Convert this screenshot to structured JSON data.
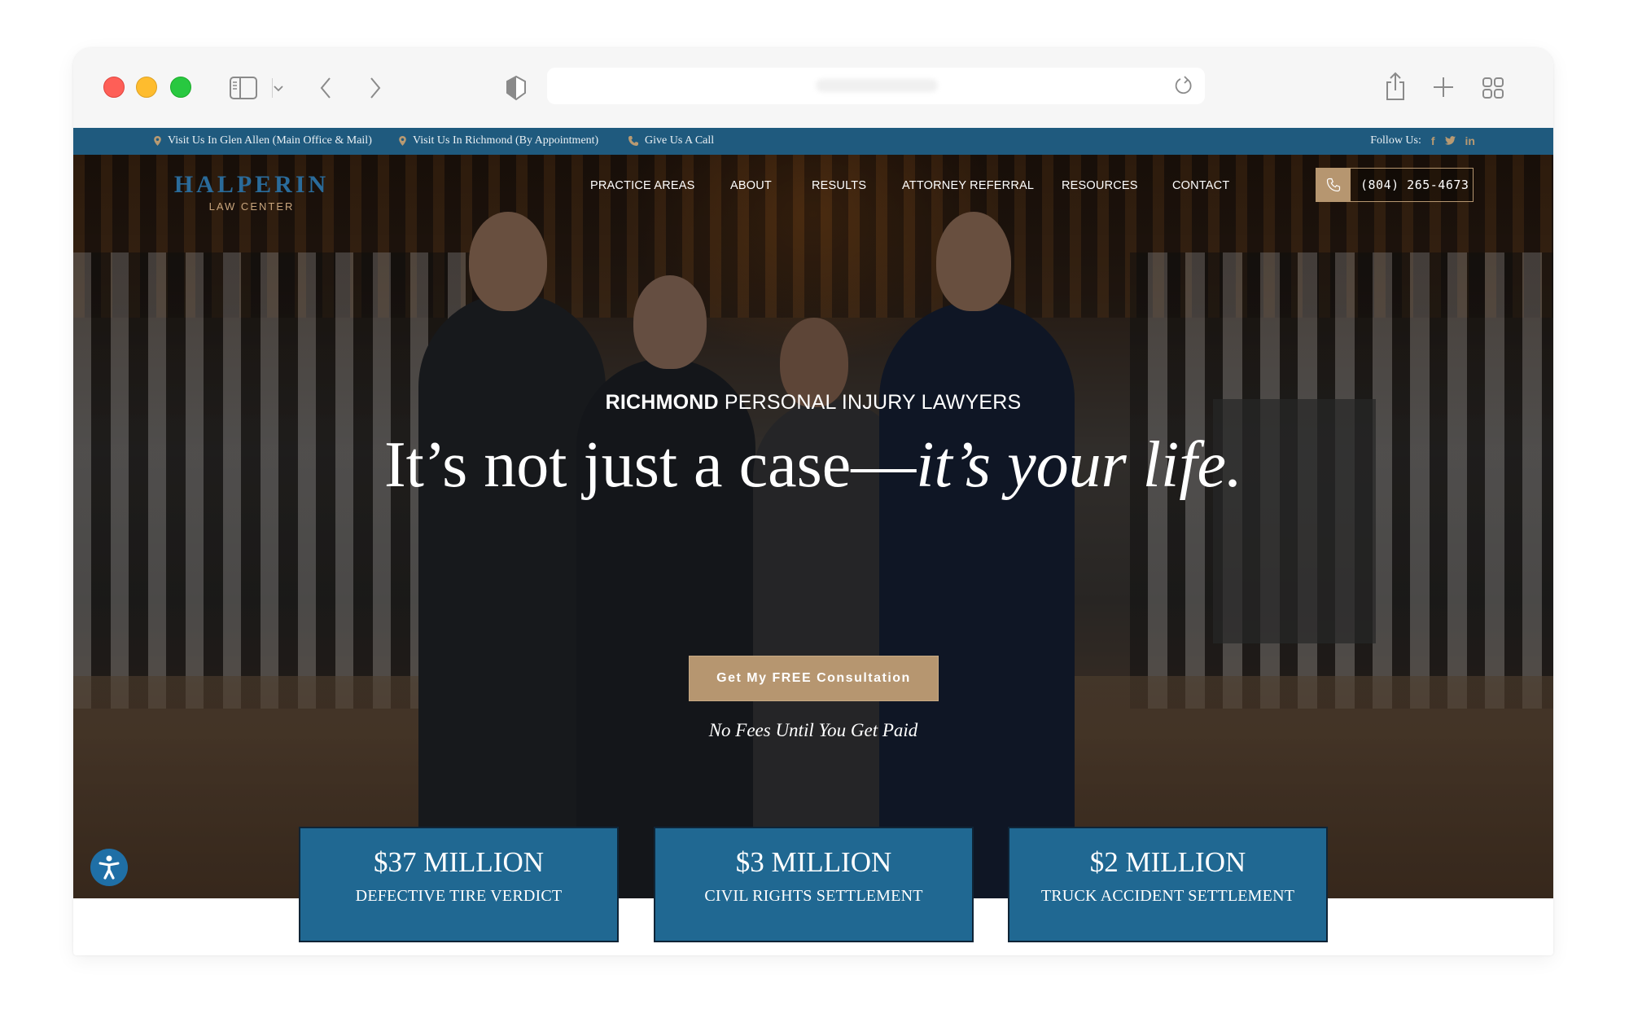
{
  "browser": {
    "traffic_lights": [
      "close",
      "minimize",
      "zoom"
    ],
    "url": ""
  },
  "topbar": {
    "items": [
      {
        "icon": "map-pin-icon",
        "label": "Visit Us In Glen Allen (Main Office & Mail)"
      },
      {
        "icon": "map-pin-icon",
        "label": "Visit Us In Richmond (By Appointment)"
      },
      {
        "icon": "phone-icon",
        "label": "Give Us A Call"
      }
    ],
    "follow_label": "Follow Us:",
    "social": [
      {
        "name": "facebook",
        "glyph": "f"
      },
      {
        "name": "twitter",
        "glyph": "t"
      },
      {
        "name": "linkedin",
        "glyph": "in"
      }
    ]
  },
  "header": {
    "logo_main": "HALPERIN",
    "logo_sub": "LAW CENTER",
    "nav": [
      "PRACTICE AREAS",
      "ABOUT",
      "RESULTS",
      "ATTORNEY REFERRAL",
      "RESOURCES",
      "CONTACT"
    ],
    "phone": "(804) 265-4673"
  },
  "hero": {
    "eyebrow_bold": "RICHMOND",
    "eyebrow_rest": " PERSONAL INJURY LAWYERS",
    "headline_regular": "It’s not just a case—",
    "headline_italic": "it’s your life.",
    "cta_label": "Get My FREE Consultation",
    "subtext": "No Fees Until You Get Paid"
  },
  "results": [
    {
      "amount": "$37 MILLION",
      "label": "DEFECTIVE TIRE VERDICT"
    },
    {
      "amount": "$3 MILLION",
      "label": "CIVIL RIGHTS SETTLEMENT"
    },
    {
      "amount": "$2 MILLION",
      "label": "TRUCK ACCIDENT SETTLEMENT"
    }
  ],
  "colors": {
    "brand_blue": "#1f5a7e",
    "card_blue": "#206892",
    "gold": "#b69670",
    "logo_blue": "#2a6b9a"
  }
}
